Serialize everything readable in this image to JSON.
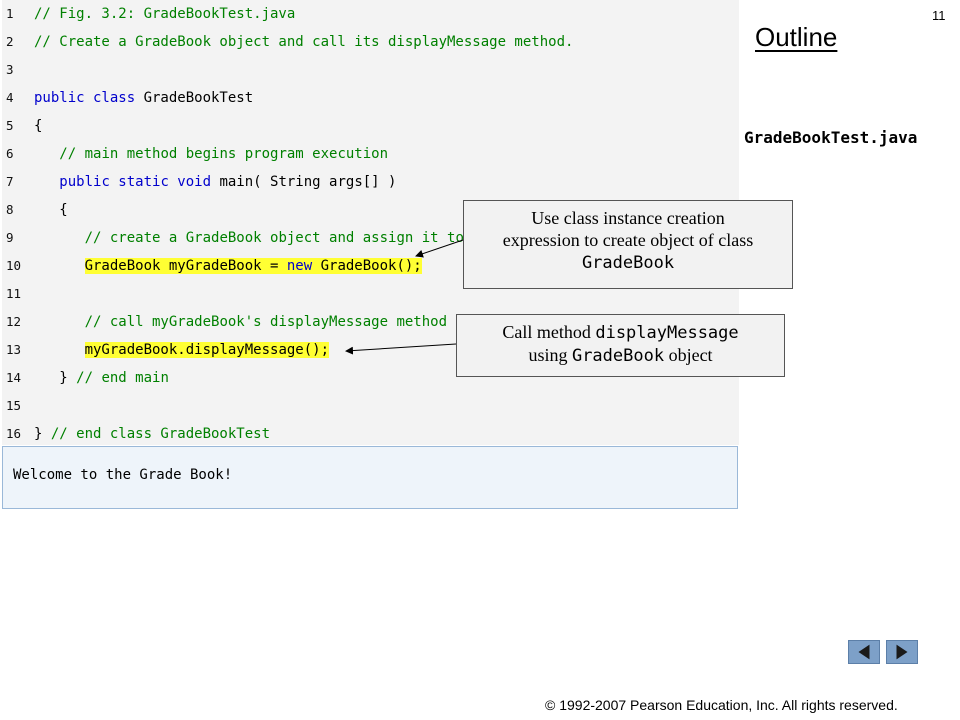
{
  "slide": {
    "page_number": "11",
    "outline_title": "Outline",
    "file_label": "GradeBookTest.java",
    "copyright": "© 1992-2007 Pearson Education, Inc.  All rights reserved."
  },
  "code": {
    "lines": [
      {
        "num": "1",
        "segments": [
          {
            "text": "// Fig. 3.2: GradeBookTest.java",
            "type": "cm"
          }
        ]
      },
      {
        "num": "2",
        "segments": [
          {
            "text": "// Create a GradeBook object and call its displayMessage method.",
            "type": "cm"
          }
        ]
      },
      {
        "num": "3",
        "segments": []
      },
      {
        "num": "4",
        "segments": [
          {
            "text": "public class ",
            "type": "kw"
          },
          {
            "text": "GradeBookTest",
            "type": "plain"
          }
        ]
      },
      {
        "num": "5",
        "segments": [
          {
            "text": "{",
            "type": "plain"
          }
        ]
      },
      {
        "num": "6",
        "segments": [
          {
            "text": "   ",
            "type": "plain"
          },
          {
            "text": "// main method begins program execution",
            "type": "cm"
          }
        ]
      },
      {
        "num": "7",
        "segments": [
          {
            "text": "   ",
            "type": "plain"
          },
          {
            "text": "public static void ",
            "type": "kw"
          },
          {
            "text": "main( String args[] )",
            "type": "plain"
          }
        ]
      },
      {
        "num": "8",
        "segments": [
          {
            "text": "   {",
            "type": "plain"
          }
        ]
      },
      {
        "num": "9",
        "segments": [
          {
            "text": "      ",
            "type": "plain"
          },
          {
            "text": "// create a GradeBook object and assign it to myGradeBook",
            "type": "cm"
          }
        ]
      },
      {
        "num": "10",
        "segments": [
          {
            "text": "      ",
            "type": "plain"
          },
          {
            "text": "GradeBook myGradeBook = ",
            "type": "hl"
          },
          {
            "text": "new ",
            "type": "hlkw"
          },
          {
            "text": "GradeBook();",
            "type": "hl"
          }
        ]
      },
      {
        "num": "11",
        "segments": []
      },
      {
        "num": "12",
        "segments": [
          {
            "text": "      ",
            "type": "plain"
          },
          {
            "text": "// call myGradeBook's displayMessage method",
            "type": "cm"
          }
        ]
      },
      {
        "num": "13",
        "segments": [
          {
            "text": "      ",
            "type": "plain"
          },
          {
            "text": "myGradeBook.displayMessage();",
            "type": "hl"
          }
        ]
      },
      {
        "num": "14",
        "segments": [
          {
            "text": "   } ",
            "type": "plain"
          },
          {
            "text": "// end main",
            "type": "cm"
          }
        ]
      },
      {
        "num": "15",
        "segments": []
      },
      {
        "num": "16",
        "segments": [
          {
            "text": "} ",
            "type": "plain"
          },
          {
            "text": "// end class GradeBookTest",
            "type": "cm"
          }
        ]
      }
    ]
  },
  "output": {
    "text": "Welcome to the Grade Book!"
  },
  "callouts": {
    "instance_creation": {
      "line1": "Use class instance creation",
      "line2": "expression to create object of class",
      "code": "GradeBook"
    },
    "display_message": {
      "prefix": "Call method ",
      "code1": "displayMessage",
      "using": "using ",
      "code2": "GradeBook",
      "suffix": " object"
    }
  },
  "navigation": {
    "prev_icon": "triangle-left-icon",
    "next_icon": "triangle-right-icon"
  },
  "colors": {
    "comment": "#008000",
    "keyword": "#0000cc",
    "highlight": "#ffff33",
    "nav_button": "#7da0c8"
  }
}
